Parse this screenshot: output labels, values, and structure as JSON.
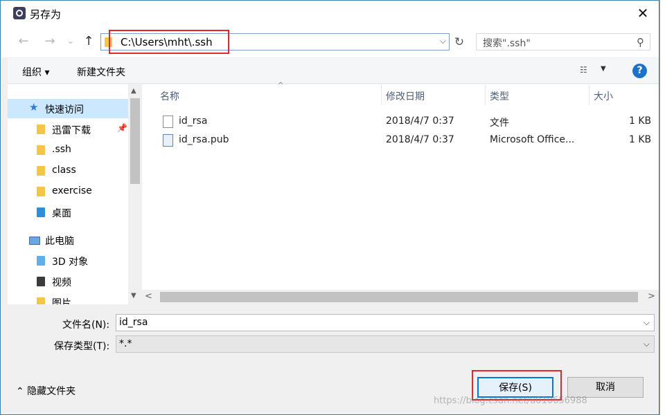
{
  "window": {
    "title": "另存为",
    "close": "✕"
  },
  "nav": {
    "back": "←",
    "forward": "→",
    "recent": "⌄",
    "up": "↑"
  },
  "address": {
    "path": "C:\\Users\\mht\\.ssh",
    "dropdown": "⌵",
    "refresh": "↻"
  },
  "search": {
    "placeholder": "搜索\".ssh\"",
    "icon": "⚲"
  },
  "toolbar": {
    "organize": "组织 ▾",
    "new_folder": "新建文件夹",
    "view_icon": "☷",
    "view_dd": "▼",
    "help": "?"
  },
  "navpane": {
    "items": [
      {
        "label": "快速访问"
      },
      {
        "label": "迅雷下载",
        "pin": "📌"
      },
      {
        "label": ".ssh"
      },
      {
        "label": "class"
      },
      {
        "label": "exercise"
      },
      {
        "label": "桌面"
      },
      {
        "label": "此电脑"
      },
      {
        "label": "3D 对象"
      },
      {
        "label": "视频"
      },
      {
        "label": "图片"
      }
    ],
    "scroll_up": "▲",
    "scroll_down": "▼"
  },
  "files": {
    "columns": [
      "名称",
      "修改日期",
      "类型",
      "大小"
    ],
    "sort_caret": "^",
    "rows": [
      {
        "name": "id_rsa",
        "date": "2018/4/7 0:37",
        "type": "文件",
        "size": "1 KB"
      },
      {
        "name": "id_rsa.pub",
        "date": "2018/4/7 0:37",
        "type": "Microsoft Office...",
        "size": "1 KB"
      }
    ],
    "scroll_left": "<",
    "scroll_right": ">"
  },
  "form": {
    "filename_label": "文件名(N):",
    "filename_value": "id_rsa",
    "filetype_label": "保存类型(T):",
    "filetype_value": "*.*",
    "dd": "⌵"
  },
  "footer": {
    "hide_folders": "⌃  隐藏文件夹",
    "save": "保存(S)",
    "cancel": "取消"
  },
  "watermark": "https://blog.csdn.net/u010656988"
}
